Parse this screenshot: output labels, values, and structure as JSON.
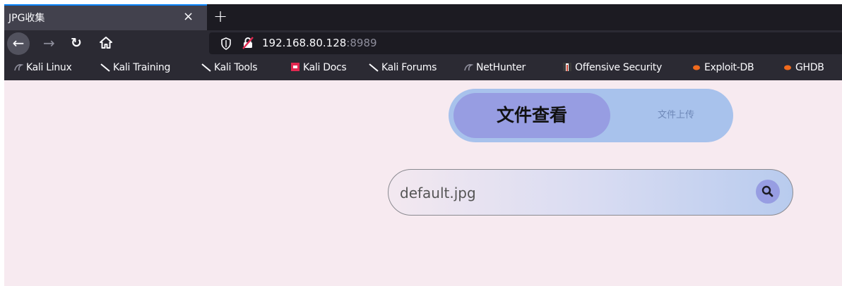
{
  "browser": {
    "tab_title": "JPG收集",
    "close_glyph": "×",
    "newtab_glyph": "+",
    "url_host": "192.168.80.128",
    "url_port": ":8989",
    "bookmarks": [
      {
        "label": "Kali Linux",
        "icon": "kali-dragon-icon"
      },
      {
        "label": "Kali Training",
        "icon": "kali-dragon-icon"
      },
      {
        "label": "Kali Tools",
        "icon": "kali-dragon-icon"
      },
      {
        "label": "Kali Docs",
        "icon": "kali-docs-icon"
      },
      {
        "label": "Kali Forums",
        "icon": "kali-dragon-icon"
      },
      {
        "label": "NetHunter",
        "icon": "nethunter-icon"
      },
      {
        "label": "Offensive Security",
        "icon": "offsec-icon"
      },
      {
        "label": "Exploit-DB",
        "icon": "exploitdb-icon"
      },
      {
        "label": "GHDB",
        "icon": "exploitdb-icon"
      }
    ]
  },
  "page": {
    "switch": {
      "active_label": "文件查看",
      "inactive_label": "文件上传"
    },
    "search": {
      "value": "default.jpg",
      "icon": "search-icon"
    }
  },
  "colors": {
    "page_bg": "#f7eaf0",
    "switch_bg": "#a8c2ec",
    "switch_active": "#979de2",
    "tabstrip": "#1c1b22",
    "toolbar": "#2b2a33"
  }
}
